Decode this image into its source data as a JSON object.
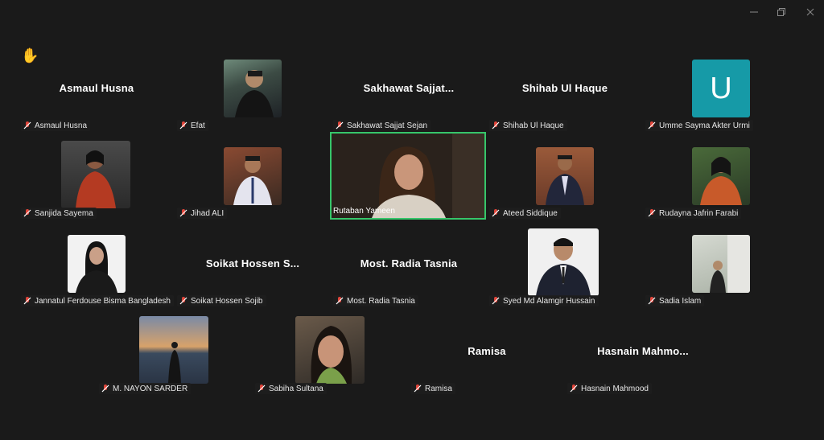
{
  "window": {
    "minimize_icon": "minimize-icon",
    "restore_icon": "restore-icon",
    "close_icon": "close-icon"
  },
  "raise_hand_icon": "✋",
  "participants": [
    {
      "big_name": "Asmaul Husna",
      "caption": "Asmaul Husna"
    },
    {
      "big_name": "",
      "caption": "Efat"
    },
    {
      "big_name": "Sakhawat  Sajjat...",
      "caption": "Sakhawat Sajjat Sejan"
    },
    {
      "big_name": "Shihab Ul Haque",
      "caption": "Shihab Ul Haque"
    },
    {
      "big_name": "",
      "avatar_letter": "U",
      "avatar_color": "#169aa7",
      "caption": "Umme Sayma Akter Urmi"
    },
    {
      "big_name": "",
      "caption": "Sanjida Sayema"
    },
    {
      "big_name": "",
      "caption": "Jihad ALI"
    },
    {
      "big_name": "",
      "caption": "Rutaban Yameen"
    },
    {
      "big_name": "",
      "caption": "Ateed Siddique"
    },
    {
      "big_name": "",
      "caption": "Rudayna Jafrin Farabi"
    },
    {
      "big_name": "",
      "caption": "Jannatul Ferdouse Bisma Bangladesh"
    },
    {
      "big_name": "Soikat  Hossen  S...",
      "caption": "Soikat Hossen Sojib"
    },
    {
      "big_name": "Most. Radia Tasnia",
      "caption": "Most. Radia Tasnia"
    },
    {
      "big_name": "",
      "caption": "Syed Md Alamgir Hussain"
    },
    {
      "big_name": "",
      "caption": "Sadia Islam"
    },
    {
      "big_name": "",
      "caption": "M. NAYON SARDER"
    },
    {
      "big_name": "",
      "caption": "Sabiha Sultana"
    },
    {
      "big_name": "Ramisa",
      "caption": "Ramisa"
    },
    {
      "big_name": "Hasnain  Mahmo...",
      "caption": "Hasnain Mahmood"
    }
  ],
  "colors": {
    "background": "#1a1a1a",
    "active_speaker_border": "#36c66a",
    "mic_muted": "#e0453a"
  }
}
